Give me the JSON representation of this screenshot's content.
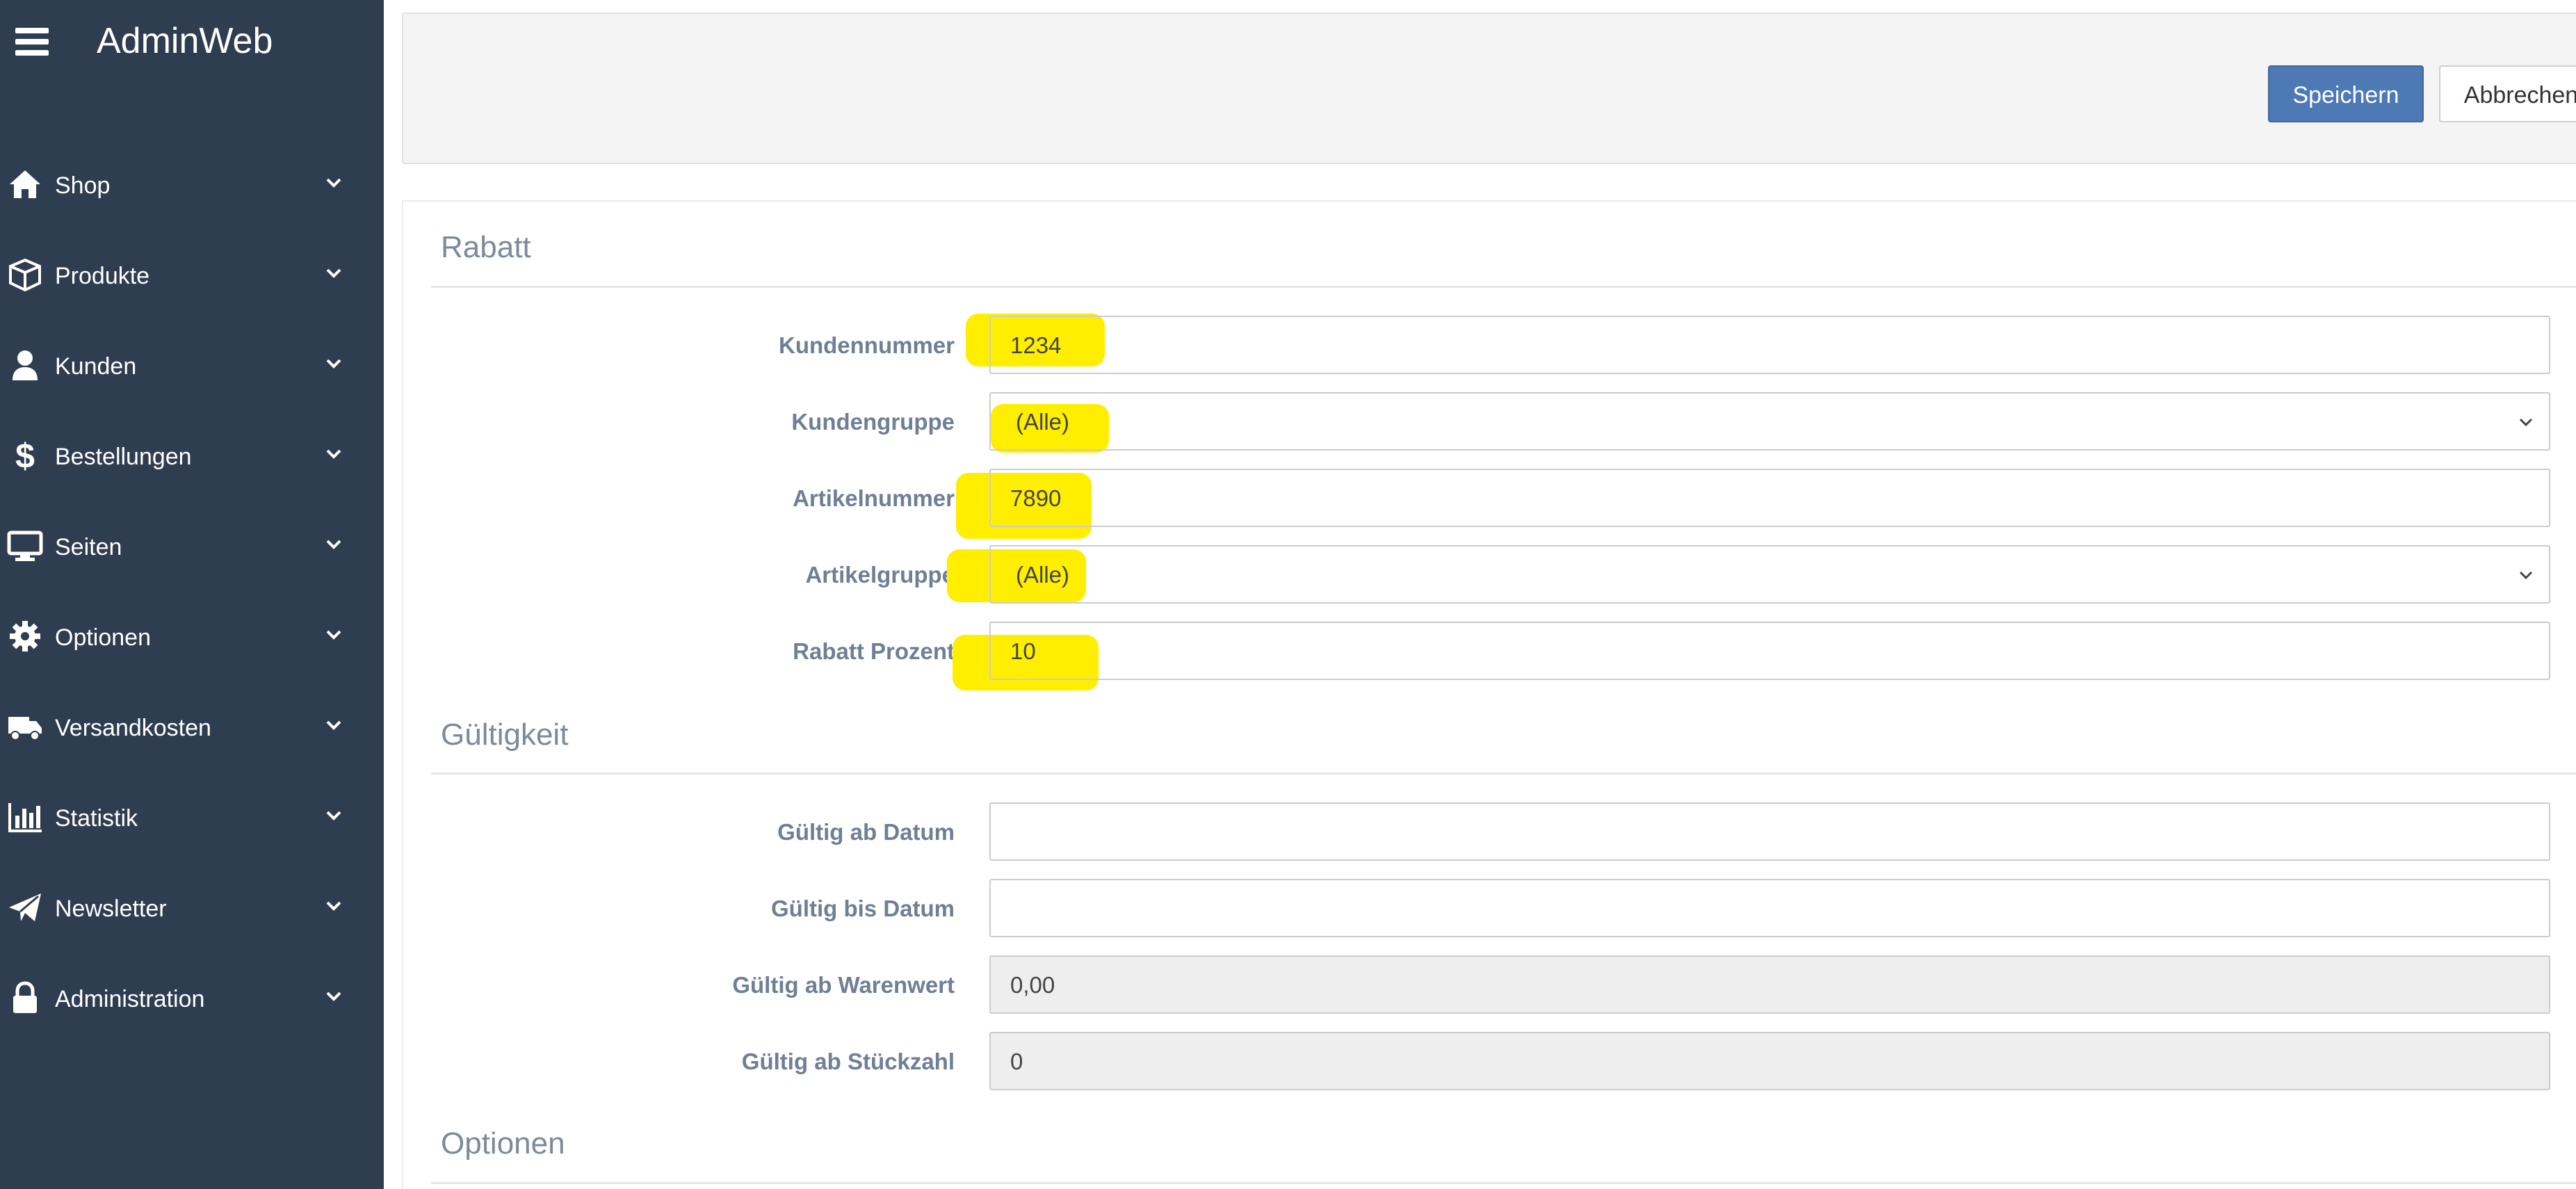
{
  "app": {
    "title": "AdminWeb"
  },
  "sidebar": {
    "items": [
      {
        "label": "Shop",
        "icon": "home-icon"
      },
      {
        "label": "Produkte",
        "icon": "box-icon"
      },
      {
        "label": "Kunden",
        "icon": "user-icon"
      },
      {
        "label": "Bestellungen",
        "icon": "dollar-icon"
      },
      {
        "label": "Seiten",
        "icon": "monitor-icon"
      },
      {
        "label": "Optionen",
        "icon": "gear-icon"
      },
      {
        "label": "Versandkosten",
        "icon": "truck-icon"
      },
      {
        "label": "Statistik",
        "icon": "bar-chart-icon"
      },
      {
        "label": "Newsletter",
        "icon": "paper-plane-icon"
      },
      {
        "label": "Administration",
        "icon": "lock-icon"
      }
    ]
  },
  "toolbar": {
    "save_label": "Speichern",
    "cancel_label": "Abbrechen"
  },
  "sections": {
    "rabatt": {
      "title": "Rabatt",
      "fields": [
        {
          "label": "Kundennummer",
          "value": "1234",
          "type": "text"
        },
        {
          "label": "Kundengruppe",
          "value": "(Alle)",
          "type": "select"
        },
        {
          "label": "Artikelnummer",
          "value": "7890",
          "type": "text"
        },
        {
          "label": "Artikelgruppe",
          "value": "(Alle)",
          "type": "select"
        },
        {
          "label": "Rabatt Prozent",
          "value": "10",
          "type": "text"
        }
      ]
    },
    "gueltigkeit": {
      "title": "Gültigkeit",
      "fields": [
        {
          "label": "Gültig ab Datum",
          "value": "",
          "type": "text"
        },
        {
          "label": "Gültig bis Datum",
          "value": "",
          "type": "text"
        },
        {
          "label": "Gültig ab Warenwert",
          "value": "0,00",
          "type": "readonly"
        },
        {
          "label": "Gültig ab Stückzahl",
          "value": "0",
          "type": "readonly"
        }
      ]
    },
    "optionen": {
      "title": "Optionen"
    }
  },
  "colors": {
    "sidebar_bg": "#2f3d50",
    "primary": "#4d79b5",
    "highlight": "#ffee00",
    "label": "#6f7f94"
  }
}
